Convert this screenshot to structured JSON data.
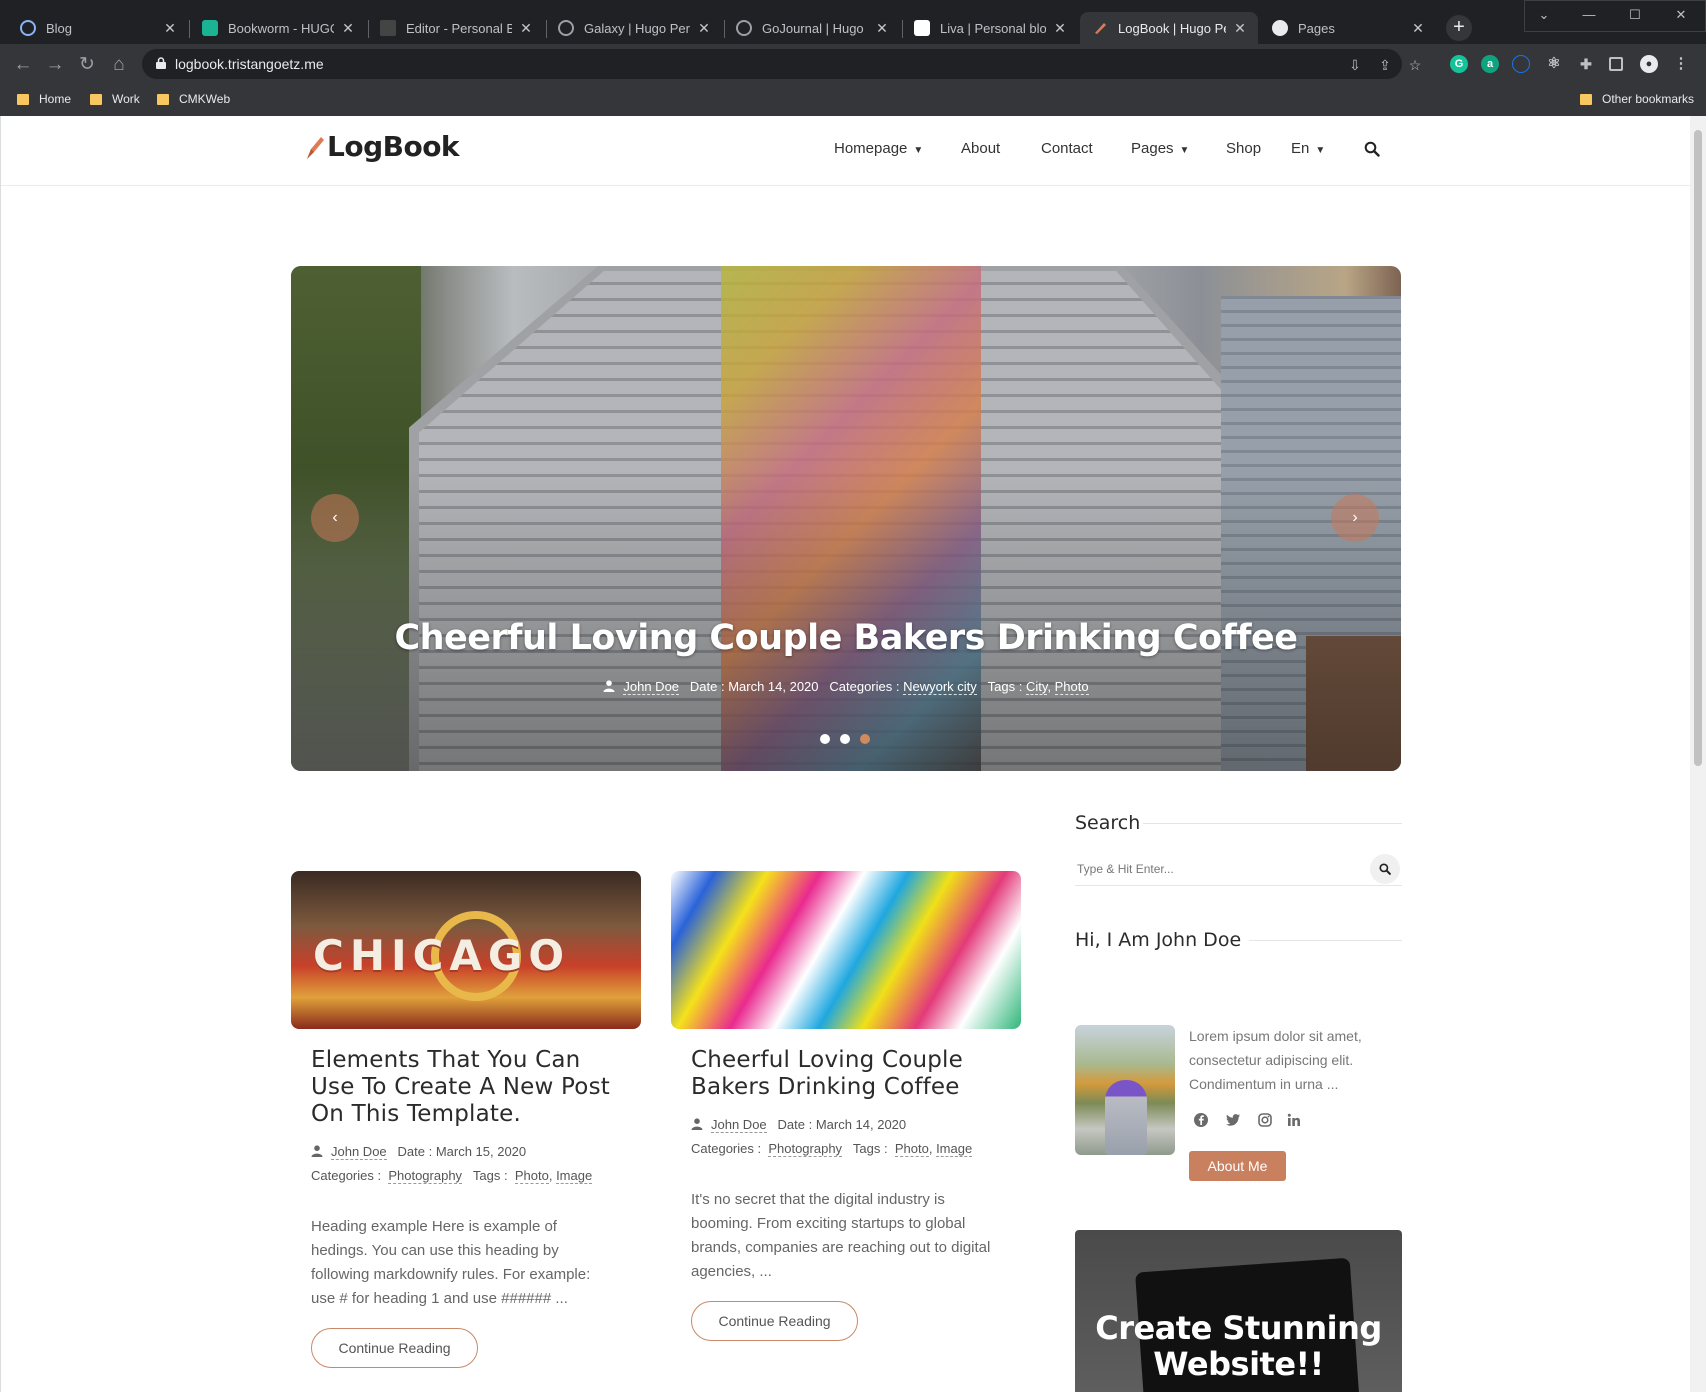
{
  "browser": {
    "tabs": [
      {
        "title": "Blog"
      },
      {
        "title": "Bookworm - HUGO B"
      },
      {
        "title": "Editor - Personal Blog"
      },
      {
        "title": "Galaxy | Hugo Person"
      },
      {
        "title": "GoJournal | Hugo Per"
      },
      {
        "title": "Liva | Personal blog te"
      },
      {
        "title": "LogBook | Hugo Perso"
      },
      {
        "title": "Pages"
      }
    ],
    "active_tab_index": 6,
    "url": "logbook.tristangoetz.me",
    "bookmarks": [
      "Home",
      "Work",
      "CMKWeb"
    ],
    "other_bookmarks": "Other bookmarks"
  },
  "site": {
    "logo": "LogBook",
    "accent_color": "#c9805e",
    "nav": {
      "homepage": "Homepage",
      "about": "About",
      "contact": "Contact",
      "pages": "Pages",
      "shop": "Shop",
      "lang": "En"
    }
  },
  "hero": {
    "title": "Cheerful Loving Couple Bakers Drinking Coffee",
    "author": "John Doe",
    "date_label": "Date :",
    "date": "March 14, 2020",
    "categories_label": "Categories :",
    "category": "Newyork city",
    "tags_label": "Tags :",
    "tag1": "City",
    "tag2": "Photo",
    "sep": ",",
    "slides": 3,
    "active_slide": 3
  },
  "posts": [
    {
      "title": "Elements That You Can Use To Create A New Post On This Template.",
      "author": "John Doe",
      "date_label": "Date :",
      "date": "March 15, 2020",
      "categories_label": "Categories :",
      "category": "Photography",
      "tags_label": "Tags :",
      "tag1": "Photo",
      "tag2": "Image",
      "image_text": "CHICAGO",
      "excerpt": "Heading example Here is example of hedings. You can use this heading by following markdownify rules. For example: use # for heading 1 and use ###### ...",
      "cta": "Continue Reading"
    },
    {
      "title": "Cheerful Loving Couple Bakers Drinking Coffee",
      "author": "John Doe",
      "date_label": "Date :",
      "date": "March 14, 2020",
      "categories_label": "Categories :",
      "category": "Photography",
      "tags_label": "Tags :",
      "tag1": "Photo",
      "tag2": "Image",
      "excerpt": "It's no secret that the digital industry is booming. From exciting startups to global brands, companies are reaching out to digital agencies, ...",
      "cta": "Continue Reading"
    }
  ],
  "sidebar": {
    "search_title": "Search",
    "search_placeholder": "Type & Hit Enter...",
    "about_title": "Hi, I Am John Doe",
    "about_text": "Lorem ipsum dolor sit amet, consectetur adipiscing elit. Condimentum in urna ...",
    "about_button": "About Me",
    "social_icons": [
      "facebook-icon",
      "twitter-icon",
      "instagram-icon",
      "linkedin-icon"
    ],
    "promo_text": "Create Stunning Website!!"
  }
}
